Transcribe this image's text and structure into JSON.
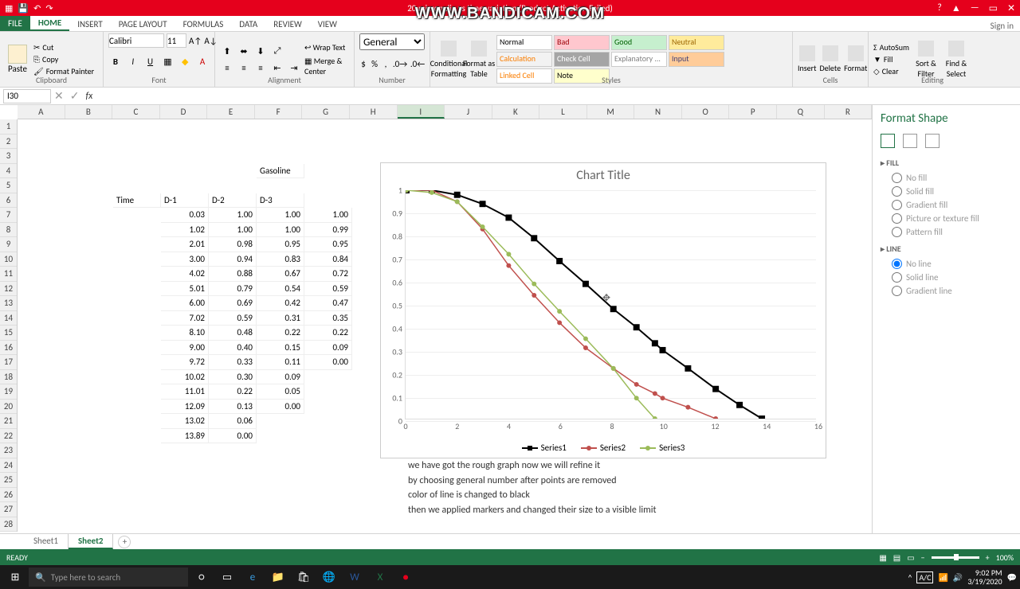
{
  "titlebar": {
    "center": "20 micron dia vs time variation (Product Activation Failed)",
    "help": "?",
    "rup": "▲",
    "min": "—",
    "max": "▭",
    "close": "✕"
  },
  "tabs": {
    "file": "FILE",
    "list": [
      "HOME",
      "INSERT",
      "PAGE LAYOUT",
      "FORMULAS",
      "DATA",
      "REVIEW",
      "VIEW"
    ],
    "active": 0,
    "signin": "Sign in"
  },
  "ribbon": {
    "clipboard": {
      "paste": "Paste",
      "cut": "Cut",
      "copy": "Copy",
      "painter": "Format Painter",
      "label": "Clipboard"
    },
    "font": {
      "name": "Calibri",
      "size": "11",
      "label": "Font"
    },
    "alignment": {
      "wrap": "Wrap Text",
      "merge": "Merge & Center",
      "label": "Alignment"
    },
    "number": {
      "format": "General",
      "label": "Number"
    },
    "styles": {
      "cond": "Conditional Formatting",
      "fmt": "Format as Table",
      "cells": [
        {
          "t": "Normal",
          "bg": "#fff",
          "c": "#000"
        },
        {
          "t": "Bad",
          "bg": "#ffc7ce",
          "c": "#9c0006"
        },
        {
          "t": "Good",
          "bg": "#c6efce",
          "c": "#006100"
        },
        {
          "t": "Neutral",
          "bg": "#ffeb9c",
          "c": "#9c6500"
        },
        {
          "t": "Calculation",
          "bg": "#f2f2f2",
          "c": "#fa7d00"
        },
        {
          "t": "Check Cell",
          "bg": "#a5a5a5",
          "c": "#fff"
        },
        {
          "t": "Explanatory ...",
          "bg": "#fff",
          "c": "#7f7f7f"
        },
        {
          "t": "Input",
          "bg": "#ffcc99",
          "c": "#3f3f76"
        },
        {
          "t": "Linked Cell",
          "bg": "#fff",
          "c": "#fa7d00"
        },
        {
          "t": "Note",
          "bg": "#ffffcc",
          "c": "#000"
        }
      ],
      "label": "Styles"
    },
    "cells": {
      "insert": "Insert",
      "delete": "Delete",
      "format": "Format",
      "label": "Cells"
    },
    "editing": {
      "sum": "AutoSum",
      "fill": "Fill",
      "clear": "Clear",
      "sort": "Sort & Filter",
      "find": "Find & Select",
      "label": "Editing"
    }
  },
  "namebox": "I30",
  "columns": [
    "A",
    "B",
    "C",
    "D",
    "E",
    "F",
    "G",
    "H",
    "I",
    "J",
    "K",
    "L",
    "M",
    "N",
    "O",
    "P",
    "Q",
    "R"
  ],
  "rows": 28,
  "sheet": {
    "header_cell": {
      "r": 4,
      "c": 6,
      "v": "Gasoline"
    },
    "headers": {
      "row": 6,
      "cols": {
        "3": "Time",
        "4": "D-1",
        "5": "D-2",
        "6": "D-3"
      }
    },
    "data": [
      {
        "t": "0.03",
        "d1": "1.00",
        "d2": "1.00",
        "d3": "1.00"
      },
      {
        "t": "1.02",
        "d1": "1.00",
        "d2": "1.00",
        "d3": "0.99"
      },
      {
        "t": "2.01",
        "d1": "0.98",
        "d2": "0.95",
        "d3": "0.95"
      },
      {
        "t": "3.00",
        "d1": "0.94",
        "d2": "0.83",
        "d3": "0.84"
      },
      {
        "t": "4.02",
        "d1": "0.88",
        "d2": "0.67",
        "d3": "0.72"
      },
      {
        "t": "5.01",
        "d1": "0.79",
        "d2": "0.54",
        "d3": "0.59"
      },
      {
        "t": "6.00",
        "d1": "0.69",
        "d2": "0.42",
        "d3": "0.47"
      },
      {
        "t": "7.02",
        "d1": "0.59",
        "d2": "0.31",
        "d3": "0.35"
      },
      {
        "t": "8.10",
        "d1": "0.48",
        "d2": "0.22",
        "d3": "0.22"
      },
      {
        "t": "9.00",
        "d1": "0.40",
        "d2": "0.15",
        "d3": "0.09"
      },
      {
        "t": "9.72",
        "d1": "0.33",
        "d2": "0.11",
        "d3": "0.00"
      },
      {
        "t": "10.02",
        "d1": "0.30",
        "d2": "0.09",
        "d3": ""
      },
      {
        "t": "11.01",
        "d1": "0.22",
        "d2": "0.05",
        "d3": ""
      },
      {
        "t": "12.09",
        "d1": "0.13",
        "d2": "0.00",
        "d3": ""
      },
      {
        "t": "13.02",
        "d1": "0.06",
        "d2": "",
        "d3": ""
      },
      {
        "t": "13.89",
        "d1": "0.00",
        "d2": "",
        "d3": ""
      }
    ],
    "notes": [
      "we have got the rough graph now we will refine it",
      "by choosing general number after points are removed",
      "color of line is changed to black",
      "then we applied markers and changed their size to a visible limit"
    ]
  },
  "chart_data": {
    "type": "line",
    "title": "Chart Title",
    "xlabel": "",
    "ylabel": "",
    "xlim": [
      0,
      16
    ],
    "ylim": [
      0,
      1
    ],
    "xticks": [
      0,
      2,
      4,
      6,
      8,
      10,
      12,
      14,
      16
    ],
    "yticks": [
      0,
      0.1,
      0.2,
      0.3,
      0.4,
      0.5,
      0.6,
      0.7,
      0.8,
      0.9,
      1
    ],
    "x": [
      0.03,
      1.02,
      2.01,
      3.0,
      4.02,
      5.01,
      6.0,
      7.02,
      8.1,
      9.0,
      9.72,
      10.02,
      11.01,
      12.09,
      13.02,
      13.89
    ],
    "series": [
      {
        "name": "Series1",
        "color": "#000",
        "marker": "square",
        "values": [
          1.0,
          1.0,
          0.98,
          0.94,
          0.88,
          0.79,
          0.69,
          0.59,
          0.48,
          0.4,
          0.33,
          0.3,
          0.22,
          0.13,
          0.06,
          0.0
        ]
      },
      {
        "name": "Series2",
        "color": "#c0504d",
        "marker": "circle",
        "values": [
          1.0,
          1.0,
          0.95,
          0.83,
          0.67,
          0.54,
          0.42,
          0.31,
          0.22,
          0.15,
          0.11,
          0.09,
          0.05,
          0.0
        ]
      },
      {
        "name": "Series3",
        "color": "#9bbb59",
        "marker": "circle",
        "values": [
          1.0,
          0.99,
          0.95,
          0.84,
          0.72,
          0.59,
          0.47,
          0.35,
          0.22,
          0.09,
          0.0
        ]
      }
    ]
  },
  "format_pane": {
    "title": "Format Shape",
    "fill": {
      "label": "FILL",
      "opts": [
        "No fill",
        "Solid fill",
        "Gradient fill",
        "Picture or texture fill",
        "Pattern fill"
      ]
    },
    "line": {
      "label": "LINE",
      "opts": [
        "No line",
        "Solid line",
        "Gradient line"
      ],
      "sel": 0
    }
  },
  "sheets": {
    "list": [
      "Sheet1",
      "Sheet2"
    ],
    "active": 1,
    "add": "+"
  },
  "status": {
    "ready": "READY",
    "zoom": "100%"
  },
  "taskbar": {
    "search": "Type here to search",
    "ac": "A/C",
    "time": "9:02 PM",
    "date": "3/19/2020"
  },
  "watermark": "WWW.BANDICAM.COM"
}
